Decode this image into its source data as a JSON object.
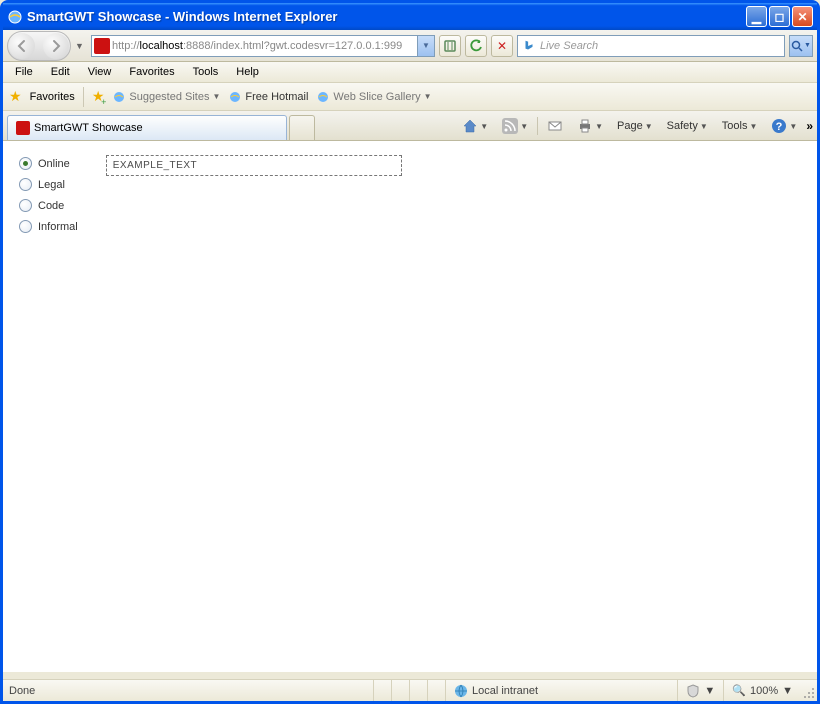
{
  "window": {
    "title": "SmartGWT Showcase - Windows Internet Explorer"
  },
  "nav": {
    "url_prefix": "http://",
    "url_host": "localhost",
    "url_rest": ":8888/index.html?gwt.codesvr=127.0.0.1:999",
    "search_placeholder": "Live Search"
  },
  "menu": {
    "file": "File",
    "edit": "Edit",
    "view": "View",
    "favorites": "Favorites",
    "tools": "Tools",
    "help": "Help"
  },
  "favbar": {
    "favorites": "Favorites",
    "suggested": "Suggested Sites",
    "hotmail": "Free Hotmail",
    "webslice": "Web Slice Gallery"
  },
  "tab": {
    "title": "SmartGWT Showcase"
  },
  "cmdbar": {
    "page": "Page",
    "safety": "Safety",
    "tools": "Tools"
  },
  "form": {
    "radios": [
      "Online",
      "Legal",
      "Code",
      "Informal"
    ],
    "selected": 0,
    "text_value": "EXAMPLE_TEXT"
  },
  "status": {
    "left": "Done",
    "zone": "Local intranet",
    "zoom": "100%"
  }
}
